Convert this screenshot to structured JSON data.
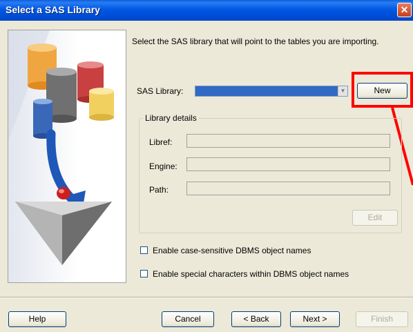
{
  "window": {
    "title": "Select a SAS Library"
  },
  "instructions": "Select the SAS library that will point to the tables you are importing.",
  "sas_library": {
    "label": "SAS Library:",
    "selected_value": ""
  },
  "buttons": {
    "new": "New",
    "edit": "Edit",
    "help": "Help",
    "cancel": "Cancel",
    "back": "< Back",
    "next": "Next >",
    "finish": "Finish"
  },
  "library_details": {
    "legend": "Library details",
    "libref_label": "Libref:",
    "engine_label": "Engine:",
    "path_label": "Path:",
    "libref_value": "",
    "engine_value": "",
    "path_value": ""
  },
  "options": [
    {
      "label": "Enable case-sensitive DBMS object names",
      "checked": false
    },
    {
      "label": "Enable special characters within DBMS object names",
      "checked": false
    }
  ],
  "colors": {
    "selection": "#316ac5",
    "annotation": "#ff0000",
    "titlebar": "#0058e6"
  }
}
